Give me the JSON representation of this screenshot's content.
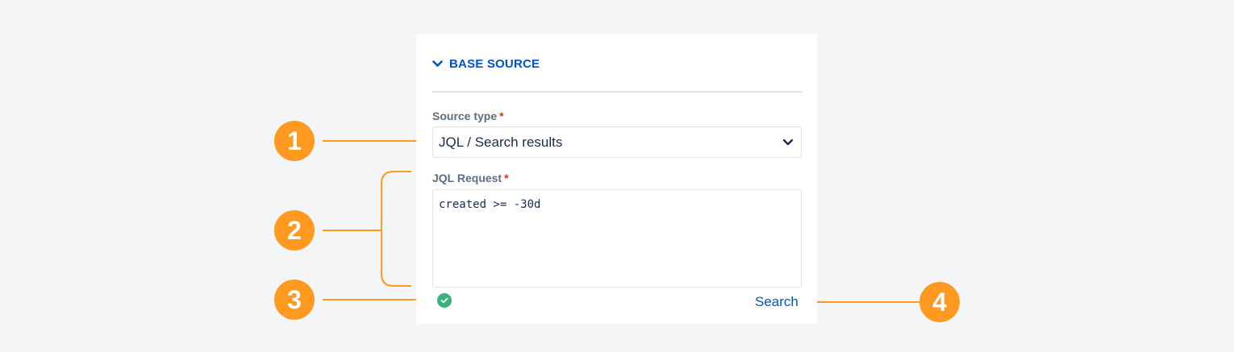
{
  "panel": {
    "section_title": "BASE SOURCE",
    "source_type": {
      "label": "Source type",
      "required_mark": "*",
      "selected_value": "JQL / Search results"
    },
    "jql_request": {
      "label": "JQL Request",
      "required_mark": "*",
      "value": "created >= -30d"
    },
    "search_label": "Search"
  },
  "callouts": [
    "1",
    "2",
    "3",
    "4"
  ],
  "colors": {
    "accent": "#0052cc",
    "callout": "#ff991f",
    "valid": "#36b37e",
    "required": "#de350b"
  },
  "icons": {
    "section_toggle": "chevron-down-icon",
    "select_arrow": "chevron-down-icon",
    "validation": "check-circle-icon"
  }
}
